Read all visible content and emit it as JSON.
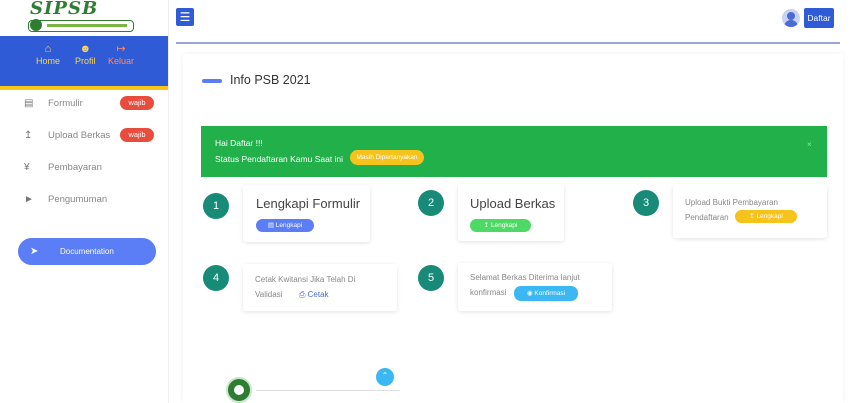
{
  "logo": {
    "text": "SIPSB"
  },
  "sidebar": {
    "top_menu": [
      {
        "label": "Home",
        "icon": "home-icon"
      },
      {
        "label": "Profil",
        "icon": "users-icon"
      },
      {
        "label": "Keluar",
        "icon": "sign-out-icon"
      }
    ],
    "items": [
      {
        "label": "Formulir",
        "icon": "form-icon",
        "badge": "wajib"
      },
      {
        "label": "Upload Berkas",
        "icon": "upload-icon",
        "badge": "wajib"
      },
      {
        "label": "Pembayaran",
        "icon": "money-icon"
      },
      {
        "label": "Pengumuman",
        "icon": "megaphone-icon"
      }
    ],
    "documentation_label": "Documentation"
  },
  "topbar": {
    "user_label": "Daftar"
  },
  "main": {
    "title": "Info PSB 2021",
    "alert": {
      "greeting": "Hai Daftar !!!",
      "status_text": "Status Pendaftaran Kamu Saat ini",
      "status_value": "Masih Dipertanyakan",
      "close": "×"
    },
    "steps": [
      {
        "number": "1",
        "title": "Lengkapi Formulir",
        "button": "Lengkapi"
      },
      {
        "number": "2",
        "title": "Upload Berkas",
        "button": "Lengkapi"
      },
      {
        "number": "3",
        "text_line1": "Upload Bukti Pembayaran",
        "text_line2": "Pendaftaran",
        "button": "Lengkapi"
      },
      {
        "number": "4",
        "text_line1": "Cetak Kwitansi Jika Telah Di",
        "text_line2": "Validasi",
        "button": "Cetak"
      },
      {
        "number": "5",
        "text_line1": "Selamat Berkas Diterima lanjut",
        "text_line2": "konfirmasi",
        "button": "Konfirmasi"
      }
    ]
  },
  "colors": {
    "primary": "#2f5bd6",
    "accent_yellow": "#f5c518",
    "success": "#22b04b",
    "danger": "#e74c3c",
    "teal": "#178a78"
  }
}
